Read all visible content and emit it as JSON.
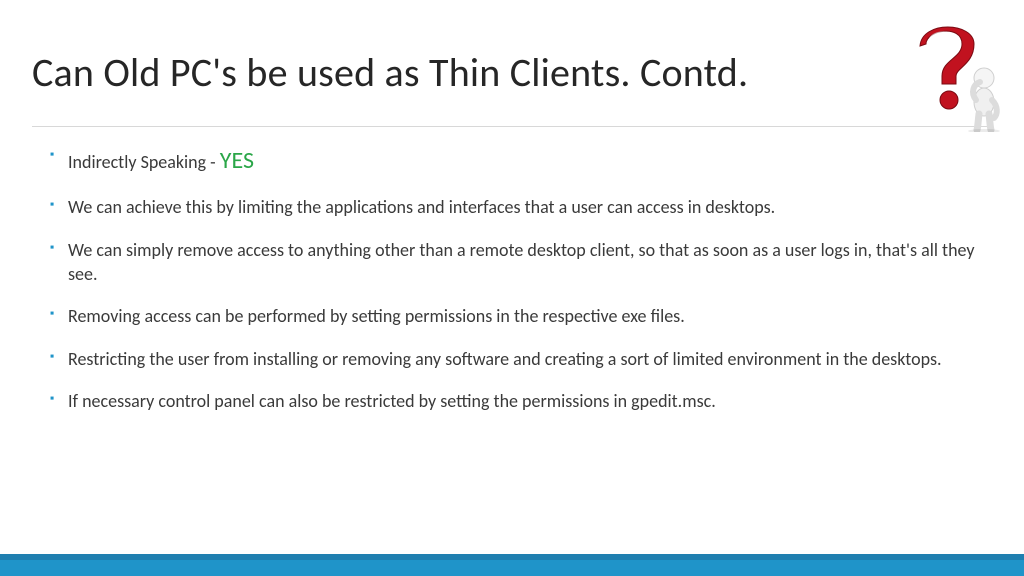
{
  "title": "Can Old PC's be used as Thin Clients. Contd.",
  "bullets": [
    {
      "prefix": "Indirectly Speaking - ",
      "emph": "YES",
      "rest": ""
    },
    {
      "text": "We can achieve this by limiting the applications and interfaces that a user can access in desktops."
    },
    {
      "text": "We can simply remove access to anything other than a remote desktop client, so that as soon as a user logs in, that's all they see."
    },
    {
      "text": "Removing access can be performed by setting permissions in the respective exe files."
    },
    {
      "text": "Restricting the user from installing or removing any software and creating a sort of limited environment in the desktops."
    },
    {
      "text": "If necessary control panel can also be restricted by setting the permissions in gpedit.msc."
    }
  ],
  "figure": {
    "name": "question-mark-figure",
    "qcolor": "#c1121f",
    "personcolor": "#e8e8e8"
  },
  "colors": {
    "accent": "#1f94c9",
    "accent_dark": "#1f7fb0"
  }
}
